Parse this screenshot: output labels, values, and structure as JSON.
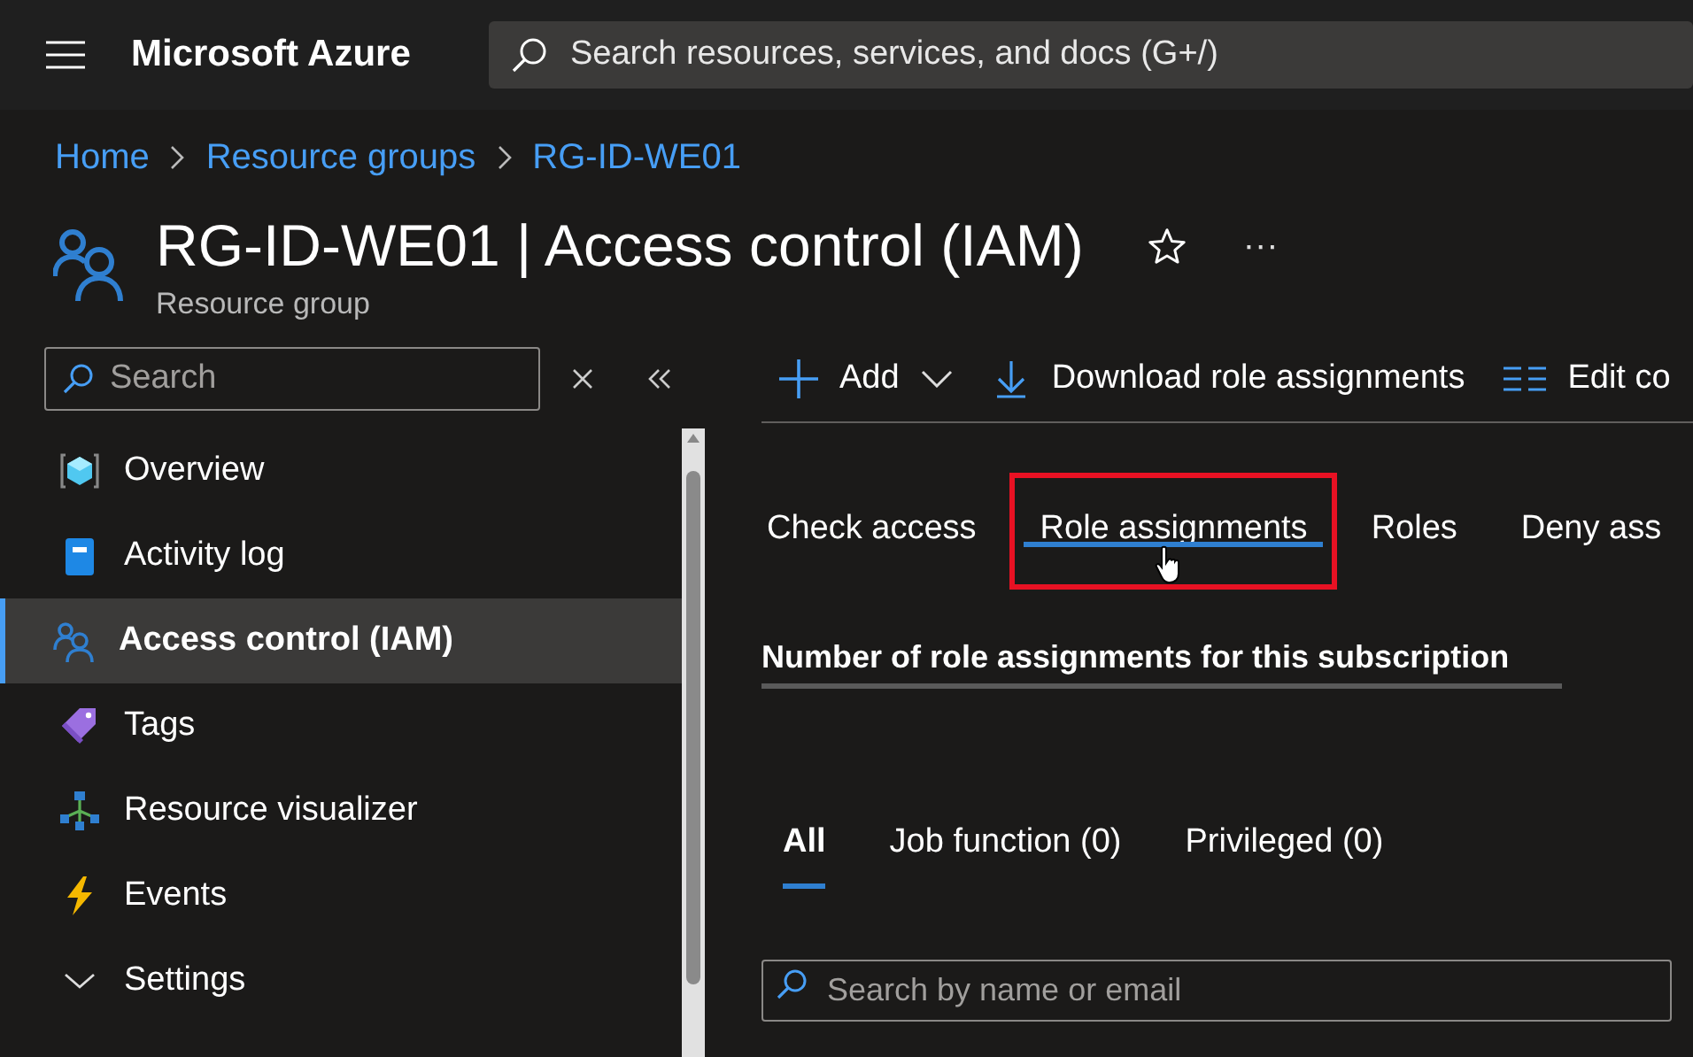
{
  "topbar": {
    "brand": "Microsoft Azure",
    "search": {
      "placeholder": "Search resources, services, and docs (G+/)"
    }
  },
  "breadcrumb": [
    "Home",
    "Resource groups",
    "RG-ID-WE01"
  ],
  "header": {
    "title": "RG-ID-WE01 | Access control (IAM)",
    "subtitle": "Resource group",
    "favorite": false,
    "more": "···"
  },
  "sidebar": {
    "search": {
      "placeholder": "Search"
    },
    "items": [
      {
        "label": "Overview",
        "kind": "link",
        "selected": false
      },
      {
        "label": "Activity log",
        "kind": "link",
        "selected": false
      },
      {
        "label": "Access control (IAM)",
        "kind": "link",
        "selected": true
      },
      {
        "label": "Tags",
        "kind": "link",
        "selected": false
      },
      {
        "label": "Resource visualizer",
        "kind": "link",
        "selected": false
      },
      {
        "label": "Events",
        "kind": "link",
        "selected": false
      },
      {
        "label": "Settings",
        "kind": "group",
        "expanded": true,
        "selected": false
      }
    ]
  },
  "toolbar": [
    {
      "label": "Add",
      "dropdown": true
    },
    {
      "label": "Download role assignments",
      "dropdown": false
    },
    {
      "label": "Edit co",
      "dropdown": false
    }
  ],
  "tabs": [
    {
      "label": "Check access",
      "selected": false,
      "highlighted": false
    },
    {
      "label": "Role assignments",
      "selected": true,
      "highlighted": true
    },
    {
      "label": "Roles",
      "selected": false,
      "highlighted": false
    },
    {
      "label": "Deny ass",
      "selected": false,
      "highlighted": false
    }
  ],
  "section_heading": "Number of role assignments for this subscription",
  "filter_tabs": [
    {
      "label": "All",
      "selected": true
    },
    {
      "label": "Job function (0)",
      "selected": false
    },
    {
      "label": "Privileged (0)",
      "selected": false
    }
  ],
  "member_search": {
    "placeholder": "Search by name or email"
  }
}
